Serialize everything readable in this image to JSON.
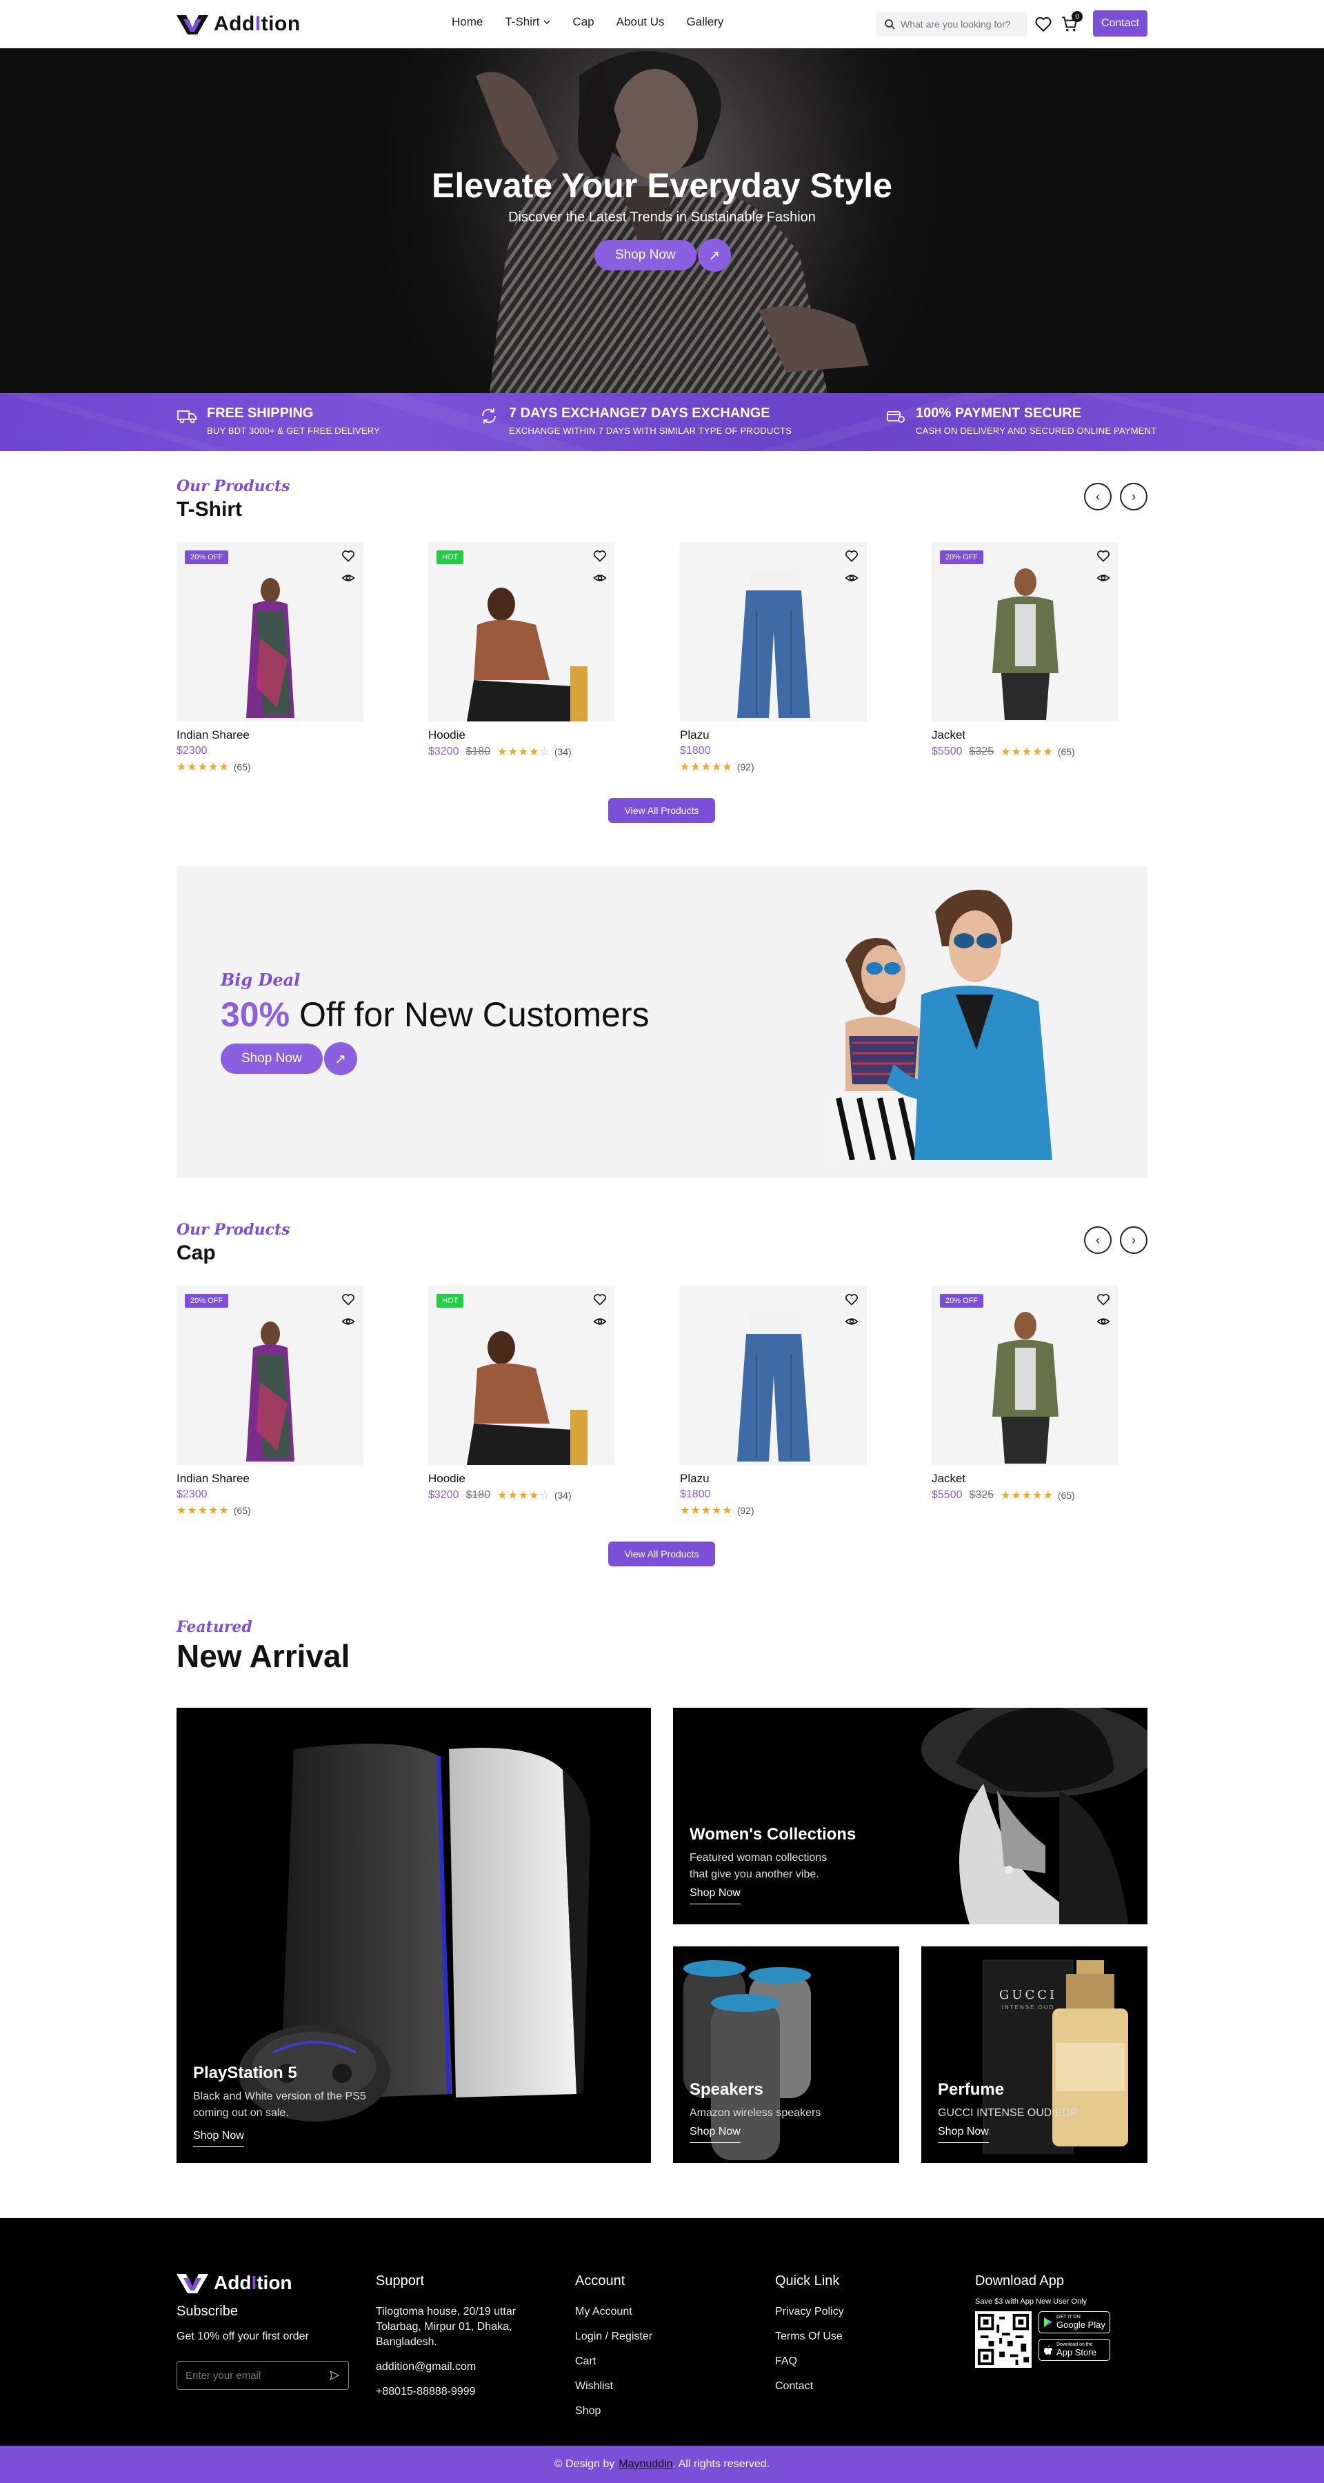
{
  "header": {
    "brand_prefix": "Add",
    "brand_i": "I",
    "brand_suffix": "tion",
    "nav": [
      "Home",
      "T-Shirt",
      "Cap",
      "About Us",
      "Gallery"
    ],
    "search_placeholder": "What are you looking for?",
    "cart_count": "0",
    "contact_label": "Contact"
  },
  "hero": {
    "title": "Elevate Your Everyday Style",
    "subtitle": "Discover the Latest Trends in Sustainable Fashion",
    "cta_label": "Shop Now",
    "cta_icon": "arrow-up-right-icon"
  },
  "features": [
    {
      "icon": "truck-icon",
      "title": "FREE SHIPPING",
      "subtitle": "BUY BDT 3000+ & GET FREE DELIVERY"
    },
    {
      "icon": "refresh-icon",
      "title": "7 DAYS EXCHANGE7 DAYS EXCHANGE",
      "subtitle": "EXCHANGE WITHIN 7 DAYS WITH SIMILAR TYPE OF PRODUCTS"
    },
    {
      "icon": "payment-icon",
      "title": "100% PAYMENT SECURE",
      "subtitle": "CASH ON DELIVERY AND SECURED ONLINE PAYMENT"
    }
  ],
  "sections": [
    {
      "eyebrow": "Our Products",
      "title": "T-Shirt",
      "view_all": "View All Products",
      "products": [
        {
          "name": "Indian Sharee",
          "badge": "20% OFF",
          "badge_type": "off",
          "price": "$2300",
          "old_price": "",
          "stars": 5,
          "reviews": "(65)"
        },
        {
          "name": "Hoodie",
          "badge": "HOT",
          "badge_type": "hot",
          "price": "$3200",
          "old_price": "$180",
          "stars": 4,
          "reviews": "(34)"
        },
        {
          "name": "Plazu",
          "badge": "",
          "badge_type": "",
          "price": "$1800",
          "old_price": "",
          "stars": 5,
          "reviews": "(92)"
        },
        {
          "name": "Jacket",
          "badge": "20% OFF",
          "badge_type": "off",
          "price": "$5500",
          "old_price": "$325",
          "stars": 5,
          "reviews": "(65)"
        }
      ]
    },
    {
      "eyebrow": "Our Products",
      "title": "Cap",
      "view_all": "View All Products",
      "products": [
        {
          "name": "Indian Sharee",
          "badge": "20% OFF",
          "badge_type": "off",
          "price": "$2300",
          "old_price": "",
          "stars": 5,
          "reviews": "(65)"
        },
        {
          "name": "Hoodie",
          "badge": "HOT",
          "badge_type": "hot",
          "price": "$3200",
          "old_price": "$180",
          "stars": 4,
          "reviews": "(34)"
        },
        {
          "name": "Plazu",
          "badge": "",
          "badge_type": "",
          "price": "$1800",
          "old_price": "",
          "stars": 5,
          "reviews": "(92)"
        },
        {
          "name": "Jacket",
          "badge": "20% OFF",
          "badge_type": "off",
          "price": "$5500",
          "old_price": "$325",
          "stars": 5,
          "reviews": "(65)"
        }
      ]
    }
  ],
  "deal": {
    "eyebrow": "Big Deal",
    "percent": "30%",
    "title_rest": " Off for New Customers",
    "cta_label": "Shop Now"
  },
  "arrival": {
    "eyebrow": "Featured",
    "title": "New Arrival",
    "tiles": {
      "ps5": {
        "title": "PlayStation 5",
        "desc": "Black and White version of the PS5 coming out on sale.",
        "link": "Shop Now"
      },
      "women": {
        "title": "Women's Collections",
        "desc": "Featured woman collections that give you another vibe.",
        "link": "Shop Now"
      },
      "speakers": {
        "title": "Speakers",
        "desc": "Amazon wireless speakers",
        "link": "Shop Now"
      },
      "perfume": {
        "title": "Perfume",
        "desc": "GUCCI INTENSE OUD EDP",
        "link": "Shop Now",
        "bottle_text": "GUCCI",
        "bottle_sub": "INTENSE OUD"
      }
    }
  },
  "footer": {
    "subscribe_title": "Subscribe",
    "subscribe_text": "Get 10% off your first order",
    "email_placeholder": "Enter your email",
    "support": {
      "title": "Support",
      "address": "Tilogtoma house, 20/19 uttar Tolarbag, Mirpur 01, Dhaka, Bangladesh.",
      "email": "addition@gmail.com",
      "phone": "+88015-88888-9999"
    },
    "account": {
      "title": "Account",
      "items": [
        "My Account",
        "Login / Register",
        "Cart",
        "Wishlist",
        "Shop"
      ]
    },
    "quick_link": {
      "title": "Quick Link",
      "items": [
        "Privacy Policy",
        "Terms Of Use",
        "FAQ",
        "Contact"
      ]
    },
    "download": {
      "title": "Download App",
      "note": "Save $3 with App New User Only",
      "google_small": "GET IT ON",
      "google_large": "Google Play",
      "apple_small": "Download on the",
      "apple_large": "App Store"
    }
  },
  "copyright": {
    "prefix": "© Design by",
    "author": "Maynuddin",
    "suffix": ". All rights reserved."
  },
  "colors": {
    "accent": "#7b4fd8",
    "hot": "#22cc44",
    "star": "#f5a623"
  }
}
